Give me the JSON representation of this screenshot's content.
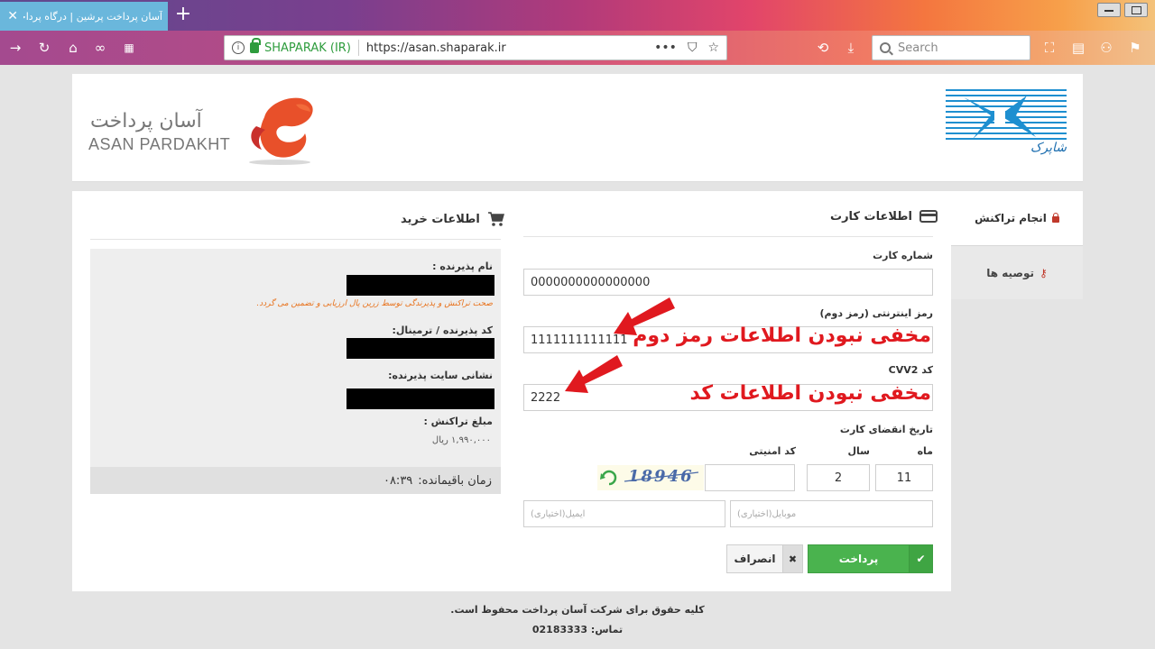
{
  "browser": {
    "tab_title": "آسان پرداخت پرشین | درگاه پرداخت :.",
    "url_org": "SHAPARAK (IR)",
    "url": "https://asan.shaparak.ir",
    "url_actions": "•••",
    "search_placeholder": "Search"
  },
  "header": {
    "asan_brand_fa": "آسان پرداخت",
    "asan_brand_en": "ASAN PARDAKHT",
    "shaparak_brand_fa": "شاپرک"
  },
  "sidebar": {
    "items": [
      {
        "label": "انجام تراکنش"
      },
      {
        "label": "توصیه ها"
      }
    ]
  },
  "card_form": {
    "title": "اطلاعات کارت",
    "card_number_label": "شماره کارت",
    "card_number_value": "0000000000000000",
    "password_label": "رمز اینترنتی (رمز دوم)",
    "password_value": "1111111111111",
    "password_annotation": "مخفی نبودن اطلاعات رمز دوم",
    "cvv2_label": "کد CVV2",
    "cvv2_value": "2222",
    "cvv2_annotation": "مخفی نبودن اطلاعات کد",
    "expiry_label": "تاریخ انقضای کارت",
    "month_label": "ماه",
    "year_label": "سال",
    "captcha_label": "کد امنیتی",
    "month_value": "11",
    "year_value": "2",
    "captcha_value": "",
    "captcha_text": "18946",
    "mobile_placeholder": "موبایل(اختیاری)",
    "email_placeholder": "ایمیل(اختیاری)",
    "pay_label": "پرداخت",
    "cancel_label": "انصراف"
  },
  "purchase": {
    "title": "اطلاعات خرید",
    "merchant_name_label": "نام پذیرنده :",
    "merchant_note": "صحت تراکنش و پذیرندگی توسط زرین پال ارزیابی و تضمین می گردد.",
    "terminal_label": "کد پذیرنده / ترمینال:",
    "site_label": "نشانی سایت پذیرنده:",
    "amount_label": "مبلغ تراکنش :",
    "amount_value": "۱,۹۹۰,۰۰۰ ریال",
    "timer_label": "زمان باقیمانده:",
    "timer_value": "۰۸:۳۹"
  },
  "footer": {
    "copyright": "کلیه حقوق برای شرکت آسان پرداخت محفوظ است.",
    "contact": "تماس: 02183333"
  },
  "colors": {
    "pay_green": "#4ab34e",
    "annotation_red": "#e0191f",
    "asan_orange": "#e8502a",
    "shaparak_blue": "#1e8fd0"
  }
}
